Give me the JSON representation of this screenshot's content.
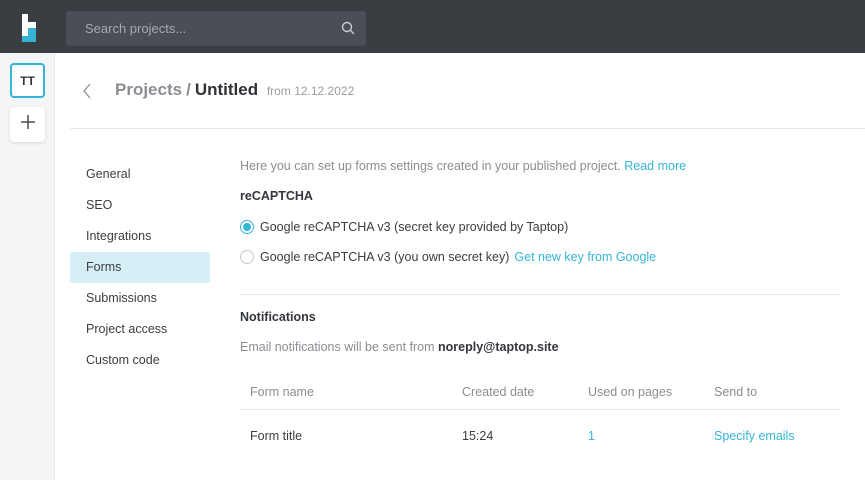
{
  "topbar": {
    "search_placeholder": "Search projects...",
    "logo_icon": "taptop-logo-icon",
    "search_icon": "search-icon"
  },
  "rail": {
    "avatar_initials": "TT",
    "add_icon": "plus-icon"
  },
  "header": {
    "crumb": "Projects",
    "separator": "/",
    "project_name": "Untitled",
    "from_text": "from 12.12.2022"
  },
  "nav": {
    "items": [
      {
        "label": "General",
        "active": false
      },
      {
        "label": "SEO",
        "active": false
      },
      {
        "label": "Integrations",
        "active": false
      },
      {
        "label": "Forms",
        "active": true
      },
      {
        "label": "Submissions",
        "active": false
      },
      {
        "label": "Project access",
        "active": false
      },
      {
        "label": "Custom code",
        "active": false
      }
    ]
  },
  "forms": {
    "intro_text": "Here you can set up forms settings created in your published project.",
    "intro_link": "Read more",
    "recaptcha_heading": "reCAPTCHA",
    "option1_label": "Google reCAPTCHA v3 (secret key provided by Taptop)",
    "option2_label": "Google reCAPTCHA v3 (you own secret key)",
    "option2_link": "Get new key from Google",
    "selected_option": 1,
    "notifications_heading": "Notifications",
    "notifications_text": "Email notifications will be sent from",
    "notifications_email": "noreply@taptop.site"
  },
  "table": {
    "headers": [
      "Form name",
      "Created date",
      "Used on pages",
      "Send to"
    ],
    "rows": [
      {
        "name": "Form title",
        "created": "15:24",
        "used_on": "1",
        "send_to": "Specify emails"
      }
    ]
  },
  "colors": {
    "accent": "#35b5d6",
    "topbar": "#3a3d42",
    "active_nav": "#d6eff6"
  }
}
